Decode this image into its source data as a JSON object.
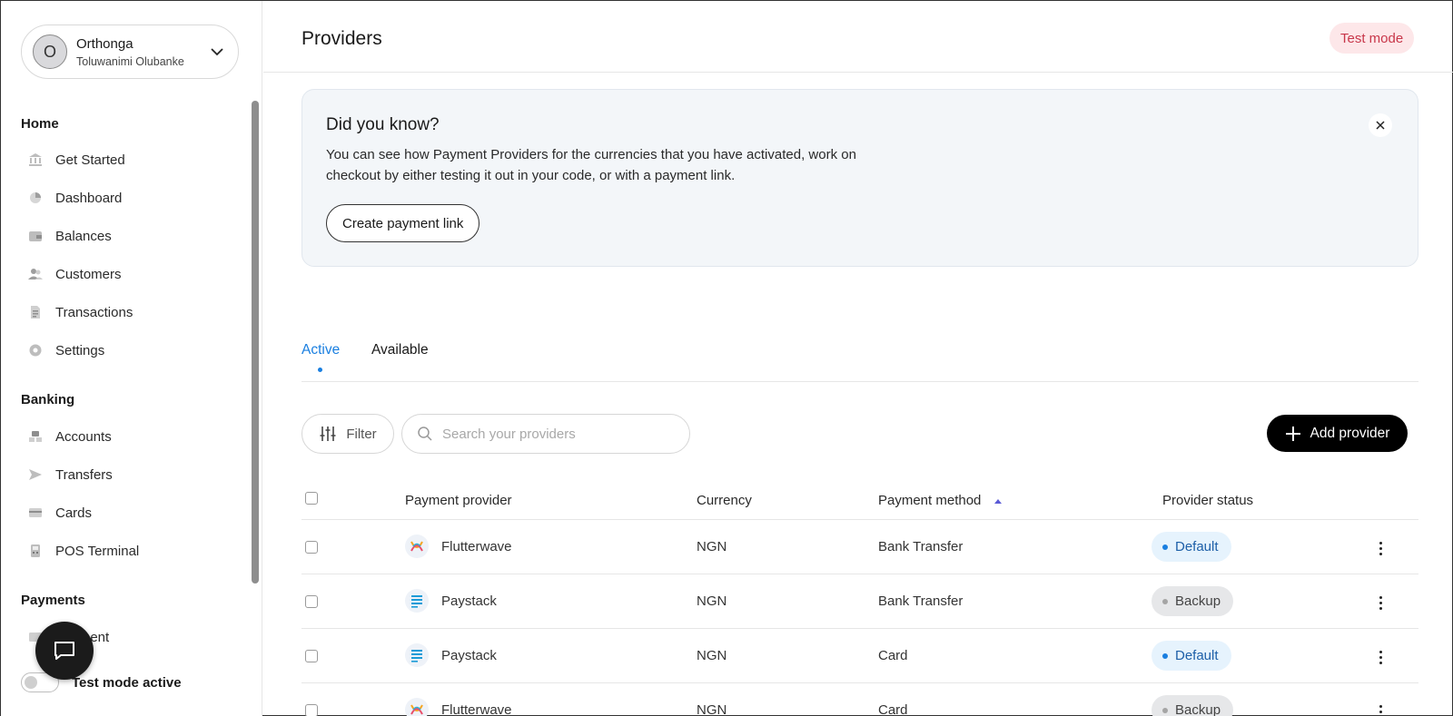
{
  "sidebar": {
    "org": {
      "avatar_letter": "O",
      "name": "Orthonga",
      "user": "Toluwanimi Olubanke"
    },
    "sections": [
      {
        "title": "Home",
        "items": [
          {
            "label": "Get Started",
            "icon": "bank-icon"
          },
          {
            "label": "Dashboard",
            "icon": "pie-chart-icon"
          },
          {
            "label": "Balances",
            "icon": "wallet-icon"
          },
          {
            "label": "Customers",
            "icon": "users-icon"
          },
          {
            "label": "Transactions",
            "icon": "receipt-icon"
          },
          {
            "label": "Settings",
            "icon": "gear-icon"
          }
        ]
      },
      {
        "title": "Banking",
        "items": [
          {
            "label": "Accounts",
            "icon": "accounts-icon"
          },
          {
            "label": "Transfers",
            "icon": "send-icon"
          },
          {
            "label": "Cards",
            "icon": "card-icon"
          },
          {
            "label": "POS Terminal",
            "icon": "pos-icon"
          }
        ]
      },
      {
        "title": "Payments",
        "items": [
          {
            "label": "Payment",
            "icon": "payment-icon"
          }
        ]
      }
    ],
    "test_mode_label": "Test mode active"
  },
  "header": {
    "title": "Providers",
    "badge": "Test mode"
  },
  "info_card": {
    "title": "Did you know?",
    "text": "You can see how Payment Providers for the currencies that you have activated, work on checkout by either testing it out in your code, or with a payment link.",
    "button": "Create payment link"
  },
  "tabs": [
    {
      "label": "Active",
      "active": true
    },
    {
      "label": "Available",
      "active": false
    }
  ],
  "toolbar": {
    "filter": "Filter",
    "search_placeholder": "Search your providers",
    "add": "Add provider"
  },
  "table": {
    "columns": [
      "Payment provider",
      "Currency",
      "Payment method",
      "Provider status"
    ],
    "rows": [
      {
        "provider": "Flutterwave",
        "currency": "NGN",
        "method": "Bank Transfer",
        "status": "Default"
      },
      {
        "provider": "Paystack",
        "currency": "NGN",
        "method": "Bank Transfer",
        "status": "Backup"
      },
      {
        "provider": "Paystack",
        "currency": "NGN",
        "method": "Card",
        "status": "Default"
      },
      {
        "provider": "Flutterwave",
        "currency": "NGN",
        "method": "Card",
        "status": "Backup"
      }
    ]
  },
  "colors": {
    "accent": "#1a7fe0",
    "badge_bg": "#fde7e9",
    "badge_text": "#c8374a",
    "primary_button": "#000000"
  }
}
